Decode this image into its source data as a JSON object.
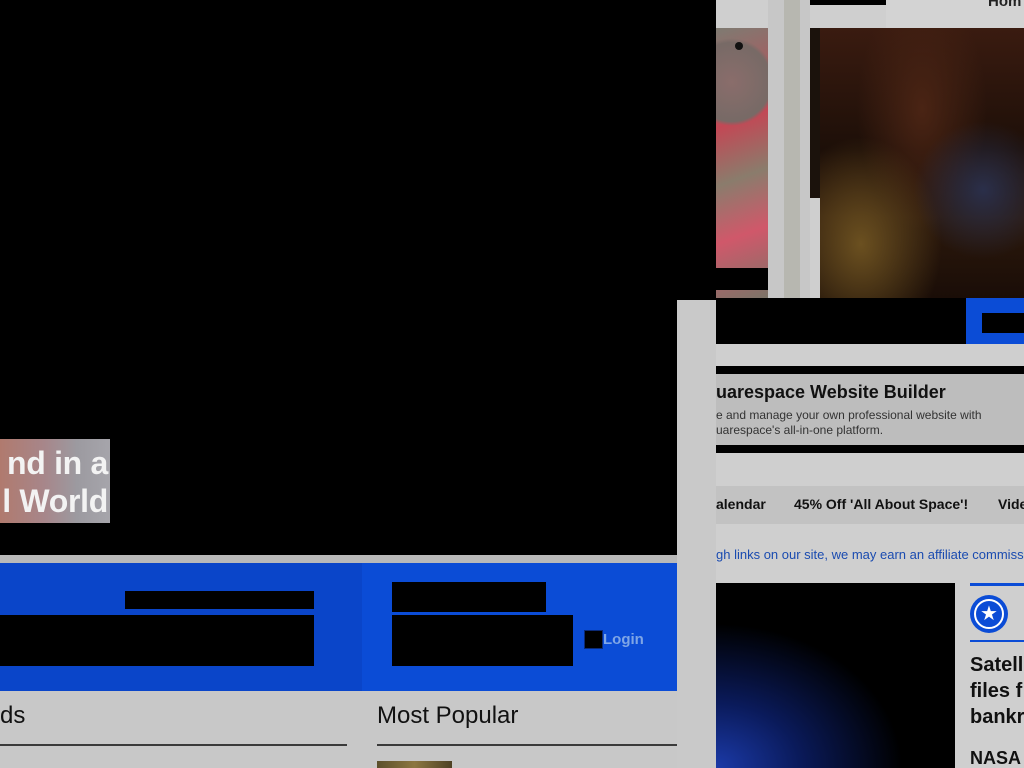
{
  "hero": {
    "caption_line_1": "nd in a",
    "caption_line_2": "l World"
  },
  "account_bar": {
    "login_label": "Login"
  },
  "sections": {
    "left_heading": "ds",
    "popular_heading": "Most Popular"
  },
  "header": {
    "home_label": "Hom"
  },
  "ad": {
    "title": "uarespace Website Builder",
    "body": "e and manage your own professional website with uarespace's all-in-one platform."
  },
  "promo_links": [
    "alendar",
    "45% Off 'All About Space'!",
    "Vide"
  ],
  "affiliate_notice": "gh links on our site, we may earn an affiliate commiss",
  "feature_card": {
    "title": "Satell files f bankr",
    "subtitle": "NASA"
  },
  "colors": {
    "brand_blue": "#0b4cd6",
    "background": "#000000",
    "link_blue": "#1a4bb0"
  },
  "icons": {
    "badge": "star-icon"
  }
}
